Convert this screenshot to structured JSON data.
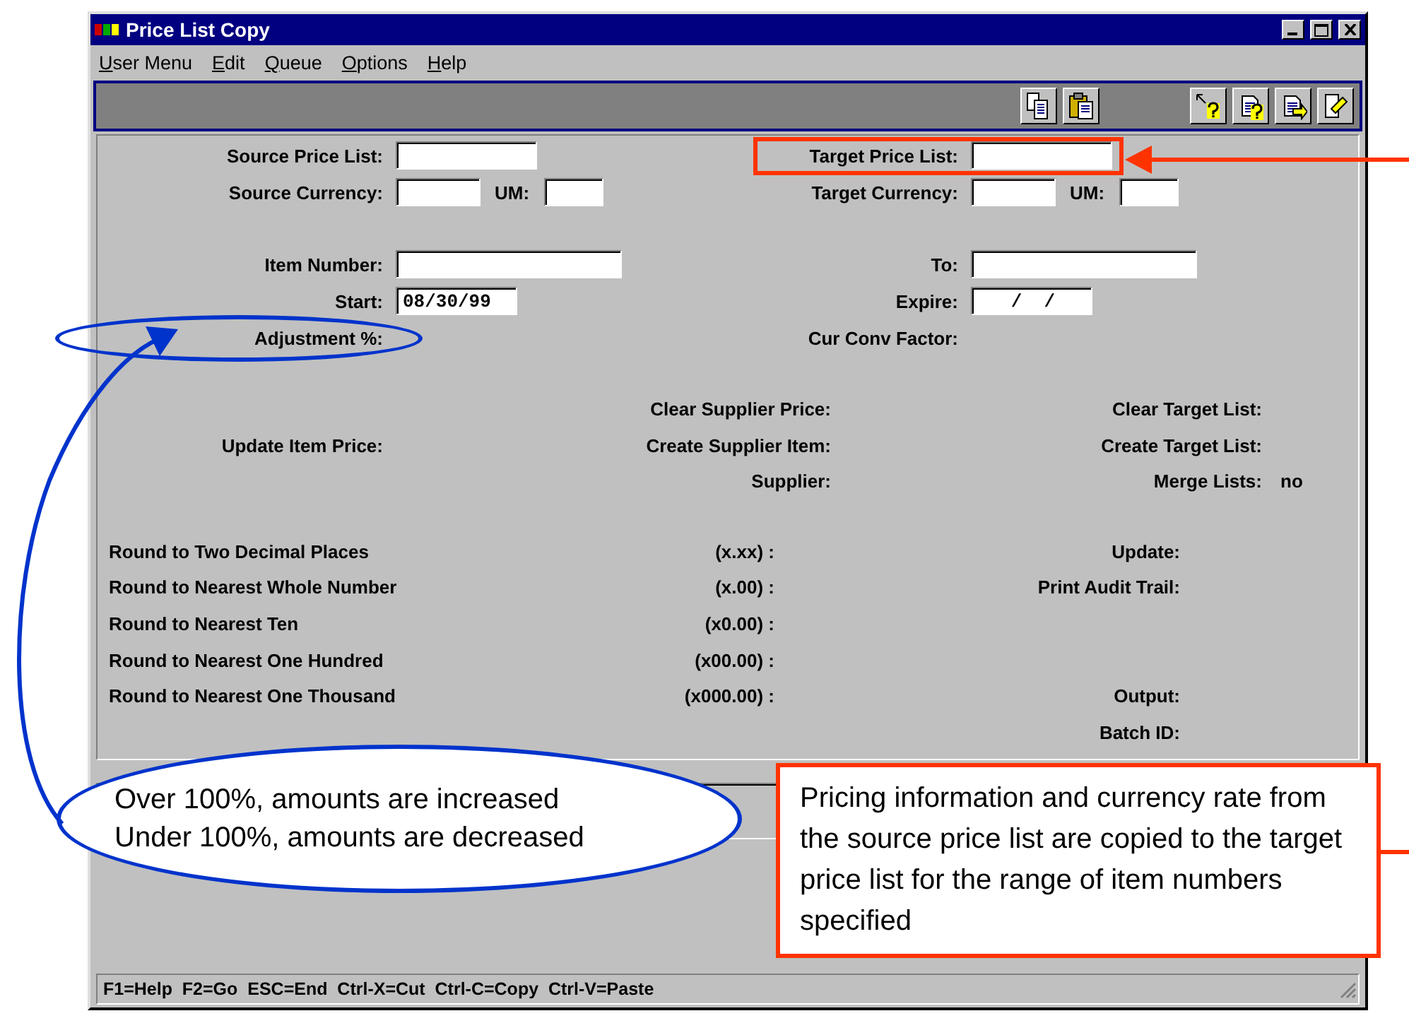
{
  "window": {
    "title": "Price List Copy"
  },
  "menu": [
    {
      "mnemonic": "U",
      "rest": "ser Menu"
    },
    {
      "mnemonic": "E",
      "rest": "dit"
    },
    {
      "mnemonic": "Q",
      "rest": "ueue"
    },
    {
      "mnemonic": "O",
      "rest": "ptions"
    },
    {
      "mnemonic": "H",
      "rest": "elp"
    }
  ],
  "header_groups": [
    [
      {
        "left": {
          "label": "Source Price List:",
          "inputs": [
            {
              "kind": "list"
            }
          ]
        },
        "right": {
          "label": "Target Price List:",
          "inputs": [
            {
              "kind": "list"
            }
          ],
          "boxed": true
        }
      },
      {
        "left": {
          "label": "Source Currency:",
          "inputs": [
            {
              "kind": "currency"
            },
            {
              "kind": "um",
              "label": "UM:"
            }
          ]
        },
        "right": {
          "label": "Target Currency:",
          "inputs": [
            {
              "kind": "currency"
            },
            {
              "kind": "um",
              "label": "UM:"
            }
          ]
        }
      }
    ],
    [
      {
        "left": {
          "label": "Item Number:",
          "inputs": [
            {
              "kind": "item"
            }
          ]
        },
        "right": {
          "label": "To:",
          "inputs": [
            {
              "kind": "item"
            }
          ]
        }
      },
      {
        "left": {
          "label": "Start:",
          "inputs": [
            {
              "kind": "date",
              "value": "08/30/99"
            }
          ]
        },
        "right": {
          "label": "Expire:",
          "inputs": [
            {
              "kind": "date",
              "value": "   /  /"
            }
          ]
        }
      },
      {
        "left": {
          "label": "Adjustment %:",
          "circled": true
        },
        "right": {
          "label": "Cur Conv Factor:"
        }
      }
    ]
  ],
  "option_rows": [
    {
      "middle": "Clear Supplier Price:",
      "right": "Clear Target List:"
    },
    {
      "left": "Update Item Price:",
      "middle": "Create Supplier Item:",
      "right": "Create Target List:"
    },
    {
      "middle": "Supplier:",
      "right": "Merge Lists:",
      "value": "no"
    }
  ],
  "rounding_rows": [
    {
      "label": "Round to Two Decimal Places",
      "format": "(x.xx) :",
      "right": "Update:"
    },
    {
      "label": "Round to Nearest Whole Number",
      "format": "(x.00) :",
      "right": "Print Audit Trail:"
    },
    {
      "label": "Round to Nearest Ten",
      "format": "(x0.00) :"
    },
    {
      "label": "Round to Nearest One Hundred",
      "format": "(x00.00) :"
    },
    {
      "label": "Round to Nearest One Thousand",
      "format": "(x000.00) :",
      "right": "Output:"
    },
    {
      "right": "Batch ID:"
    }
  ],
  "status_bar": "F1=Help  F2=Go  ESC=End  Ctrl-X=Cut  Ctrl-C=Copy  Ctrl-V=Paste",
  "callouts": [
    {
      "kind": "ellipse",
      "lines": [
        "Over 100%, amounts are increased",
        "Under 100%, amounts are decreased"
      ]
    },
    {
      "kind": "box",
      "text": "Pricing information and currency rate from the source price list are copied to the target price list for the range of item numbers specified"
    }
  ]
}
